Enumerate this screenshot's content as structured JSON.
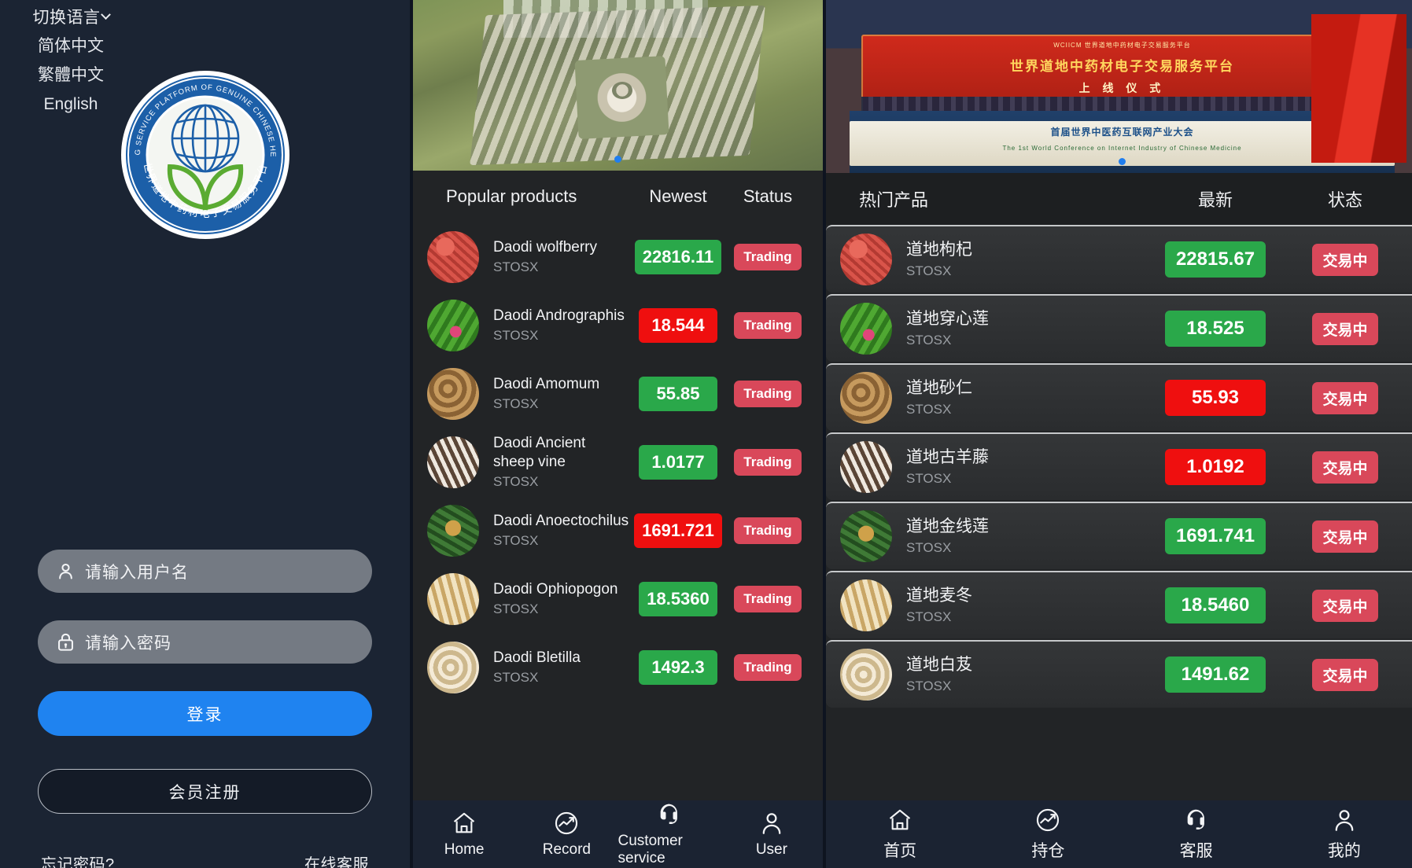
{
  "login": {
    "lang_switch": {
      "label": "切换语言",
      "chevron_icon": "chevron-down-icon",
      "options": [
        "简体中文",
        "繁體中文",
        "English"
      ]
    },
    "logo": {
      "outer_text_en": "WORLD E-TRADING SERVICE PLATFORM OF GENUINE CHINESE HERBAL MEDICINES",
      "outer_text_cn": "世界道地中药材电子交易服务平台"
    },
    "username_field": {
      "icon": "user-icon",
      "placeholder": "请输入用户名",
      "value": ""
    },
    "password_field": {
      "icon": "lock-icon",
      "placeholder": "请输入密码",
      "value": ""
    },
    "login_button": "登录",
    "register_button": "会员注册",
    "forgot_link": "忘记密码?",
    "support_link": "在线客服"
  },
  "colors": {
    "accent_blue": "#1f83f0",
    "up_green": "#2aa84a",
    "down_red": "#ef0f0f",
    "badge_red": "#d9485a",
    "login_bg": "#1b2433",
    "panel_bg": "#222426"
  },
  "panel_en": {
    "hero": {
      "art": "aerial-campus-photo",
      "dots": [
        true,
        false
      ]
    },
    "columns": {
      "name": "Popular products",
      "price": "Newest",
      "status": "Status"
    },
    "rows": [
      {
        "name": "Daodi wolfberry",
        "code": "STOSX",
        "price": "22816.11",
        "dir": "up",
        "status": "Trading",
        "thumb": "wolfberry"
      },
      {
        "name": "Daodi Andrographis",
        "code": "STOSX",
        "price": "18.544",
        "dir": "down",
        "status": "Trading",
        "thumb": "andrographis"
      },
      {
        "name": "Daodi Amomum",
        "code": "STOSX",
        "price": "55.85",
        "dir": "up",
        "status": "Trading",
        "thumb": "amomum"
      },
      {
        "name": "Daodi Ancient sheep vine",
        "code": "STOSX",
        "price": "1.0177",
        "dir": "up",
        "status": "Trading",
        "thumb": "sheepvine"
      },
      {
        "name": "Daodi Anoectochilus",
        "code": "STOSX",
        "price": "1691.721",
        "dir": "down",
        "status": "Trading",
        "thumb": "anoectochilus"
      },
      {
        "name": "Daodi Ophiopogon",
        "code": "STOSX",
        "price": "18.5360",
        "dir": "up",
        "status": "Trading",
        "thumb": "ophiopogon"
      },
      {
        "name": "Daodi Bletilla",
        "code": "STOSX",
        "price": "1492.3",
        "dir": "up",
        "status": "Trading",
        "thumb": "bletilla"
      }
    ],
    "tabs": [
      {
        "label": "Home",
        "icon": "home-icon"
      },
      {
        "label": "Record",
        "icon": "chart-circle-icon"
      },
      {
        "label": "Customer service",
        "icon": "headset-icon"
      },
      {
        "label": "User",
        "icon": "person-icon"
      }
    ]
  },
  "panel_cn": {
    "hero": {
      "art": "conference-ceremony-photo",
      "dots": [
        false,
        true
      ]
    },
    "columns": {
      "name": "热门产品",
      "price": "最新",
      "status": "状态"
    },
    "rows": [
      {
        "name": "道地枸杞",
        "code": "STOSX",
        "price": "22815.67",
        "dir": "up",
        "status": "交易中",
        "thumb": "wolfberry"
      },
      {
        "name": "道地穿心莲",
        "code": "STOSX",
        "price": "18.525",
        "dir": "up",
        "status": "交易中",
        "thumb": "andrographis"
      },
      {
        "name": "道地砂仁",
        "code": "STOSX",
        "price": "55.93",
        "dir": "down",
        "status": "交易中",
        "thumb": "amomum"
      },
      {
        "name": "道地古羊藤",
        "code": "STOSX",
        "price": "1.0192",
        "dir": "down",
        "status": "交易中",
        "thumb": "sheepvine"
      },
      {
        "name": "道地金线莲",
        "code": "STOSX",
        "price": "1691.741",
        "dir": "up",
        "status": "交易中",
        "thumb": "anoectochilus"
      },
      {
        "name": "道地麦冬",
        "code": "STOSX",
        "price": "18.5460",
        "dir": "up",
        "status": "交易中",
        "thumb": "ophiopogon"
      },
      {
        "name": "道地白芨",
        "code": "STOSX",
        "price": "1491.62",
        "dir": "up",
        "status": "交易中",
        "thumb": "bletilla"
      }
    ],
    "tabs": [
      {
        "label": "首页",
        "icon": "home-icon"
      },
      {
        "label": "持仓",
        "icon": "chart-circle-icon"
      },
      {
        "label": "客服",
        "icon": "headset-icon"
      },
      {
        "label": "我的",
        "icon": "person-icon"
      }
    ]
  },
  "hero_banner_text": {
    "line1": "WCIICM 世界道地中药材电子交易服务平台",
    "line2": "世界道地中药材电子交易服务平台",
    "line3": "上 线 仪 式",
    "lower1": "首届世界中医药互联网产业大会",
    "lower2": "The 1st World Conference on Internet Industry of Chinese Medicine"
  }
}
